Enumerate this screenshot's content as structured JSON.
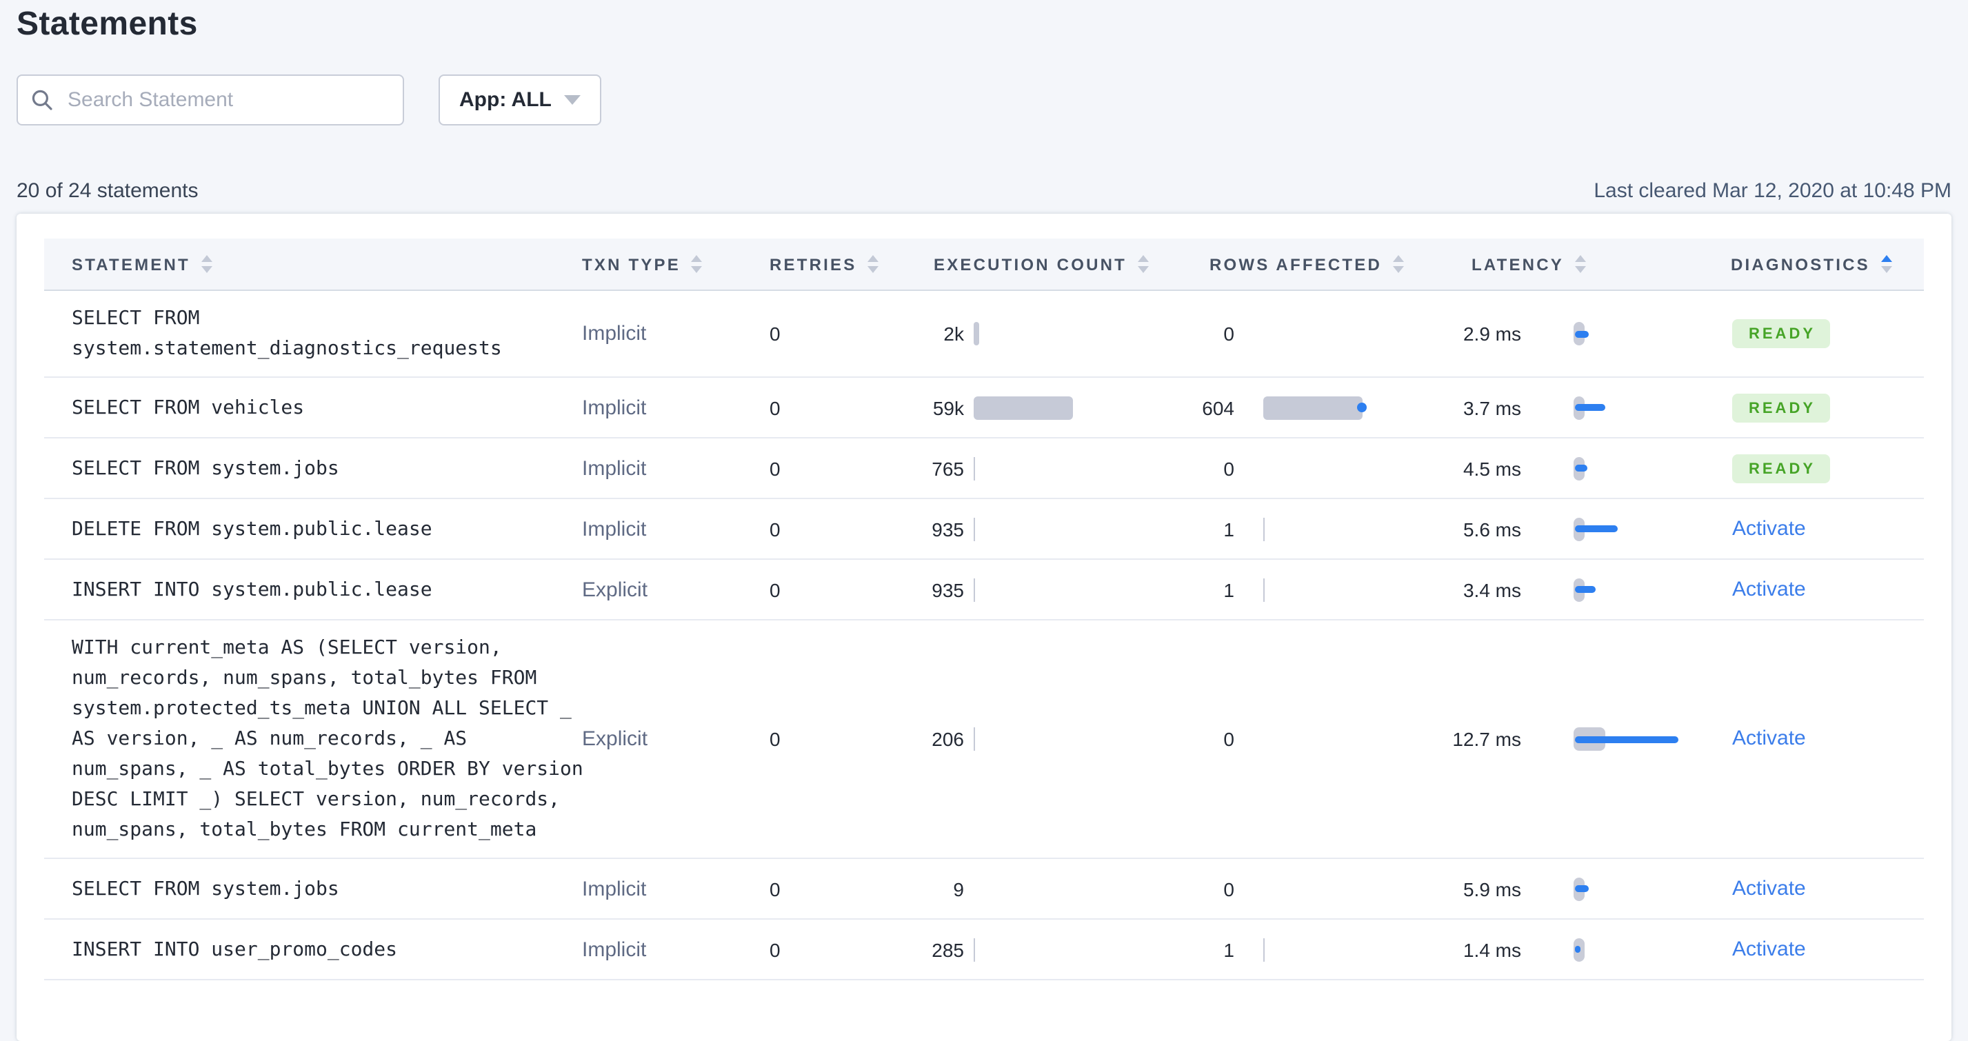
{
  "page": {
    "title": "Statements",
    "search_placeholder": "Search Statement",
    "app_filter_label": "App: ALL",
    "count_summary": "20 of 24 statements",
    "last_cleared": "Last cleared Mar 12, 2020 at 10:48 PM"
  },
  "colors": {
    "page_bg": "#F4F6FA",
    "accent": "#2D7FF0",
    "bar_gray": "#C6CAD7",
    "badge_bg": "#DFF3DA",
    "badge_text": "#46A427",
    "link": "#3B7DEA"
  },
  "table": {
    "columns": [
      {
        "label": "STATEMENT",
        "sort": null
      },
      {
        "label": "TXN TYPE",
        "sort": null
      },
      {
        "label": "RETRIES",
        "sort": null
      },
      {
        "label": "EXECUTION COUNT",
        "sort": null
      },
      {
        "label": "ROWS AFFECTED",
        "sort": null
      },
      {
        "label": "LATENCY",
        "sort": null
      },
      {
        "label": "DIAGNOSTICS",
        "sort": "asc"
      }
    ],
    "rows": [
      {
        "statement": "SELECT FROM system.statement_diagnostics_requests",
        "txn_type": "Implicit",
        "retries": "0",
        "execution_count": "2k",
        "rows_affected": "0",
        "latency": "2.9 ms",
        "diagnostics": {
          "type": "badge",
          "label": "READY"
        },
        "bars": {
          "exec": 4,
          "rows": 0,
          "rows_dot": false,
          "latency": 10,
          "latency_capsule": 8
        }
      },
      {
        "statement": "SELECT FROM vehicles",
        "txn_type": "Implicit",
        "retries": "0",
        "execution_count": "59k",
        "rows_affected": "604",
        "latency": "3.7 ms",
        "diagnostics": {
          "type": "badge",
          "label": "READY"
        },
        "bars": {
          "exec": 72,
          "rows": 72,
          "rows_dot": true,
          "latency": 22,
          "latency_capsule": 8
        }
      },
      {
        "statement": "SELECT FROM system.jobs",
        "txn_type": "Implicit",
        "retries": "0",
        "execution_count": "765",
        "rows_affected": "0",
        "latency": "4.5 ms",
        "diagnostics": {
          "type": "badge",
          "label": "READY"
        },
        "bars": {
          "exec": 1,
          "rows": 0,
          "rows_dot": false,
          "latency": 9,
          "latency_capsule": 8
        }
      },
      {
        "statement": "DELETE FROM system.public.lease",
        "txn_type": "Implicit",
        "retries": "0",
        "execution_count": "935",
        "rows_affected": "1",
        "latency": "5.6 ms",
        "diagnostics": {
          "type": "link",
          "label": "Activate"
        },
        "bars": {
          "exec": 1,
          "rows": 1,
          "rows_dot": false,
          "latency": 31,
          "latency_capsule": 8
        }
      },
      {
        "statement": "INSERT INTO system.public.lease",
        "txn_type": "Explicit",
        "retries": "0",
        "execution_count": "935",
        "rows_affected": "1",
        "latency": "3.4 ms",
        "diagnostics": {
          "type": "link",
          "label": "Activate"
        },
        "bars": {
          "exec": 1,
          "rows": 1,
          "rows_dot": false,
          "latency": 15,
          "latency_capsule": 8
        }
      },
      {
        "statement": "WITH current_meta AS (SELECT version, num_records, num_spans, total_bytes FROM system.protected_ts_meta UNION ALL SELECT _ AS version, _ AS num_records, _ AS num_spans, _ AS total_bytes ORDER BY version DESC LIMIT _) SELECT version, num_records, num_spans, total_bytes FROM current_meta",
        "txn_type": "Explicit",
        "retries": "0",
        "execution_count": "206",
        "rows_affected": "0",
        "latency": "12.7 ms",
        "diagnostics": {
          "type": "link",
          "label": "Activate"
        },
        "bars": {
          "exec": 1,
          "rows": 0,
          "rows_dot": false,
          "latency": 75,
          "latency_capsule": 23
        }
      },
      {
        "statement": "SELECT FROM system.jobs",
        "txn_type": "Implicit",
        "retries": "0",
        "execution_count": "9",
        "rows_affected": "0",
        "latency": "5.9 ms",
        "diagnostics": {
          "type": "link",
          "label": "Activate"
        },
        "bars": {
          "exec": 0,
          "rows": 0,
          "rows_dot": false,
          "latency": 10,
          "latency_capsule": 8
        }
      },
      {
        "statement": "INSERT INTO user_promo_codes",
        "txn_type": "Implicit",
        "retries": "0",
        "execution_count": "285",
        "rows_affected": "1",
        "latency": "1.4 ms",
        "diagnostics": {
          "type": "link",
          "label": "Activate"
        },
        "bars": {
          "exec": 1,
          "rows": 1,
          "rows_dot": false,
          "latency": 4,
          "latency_capsule": 8
        }
      }
    ]
  }
}
